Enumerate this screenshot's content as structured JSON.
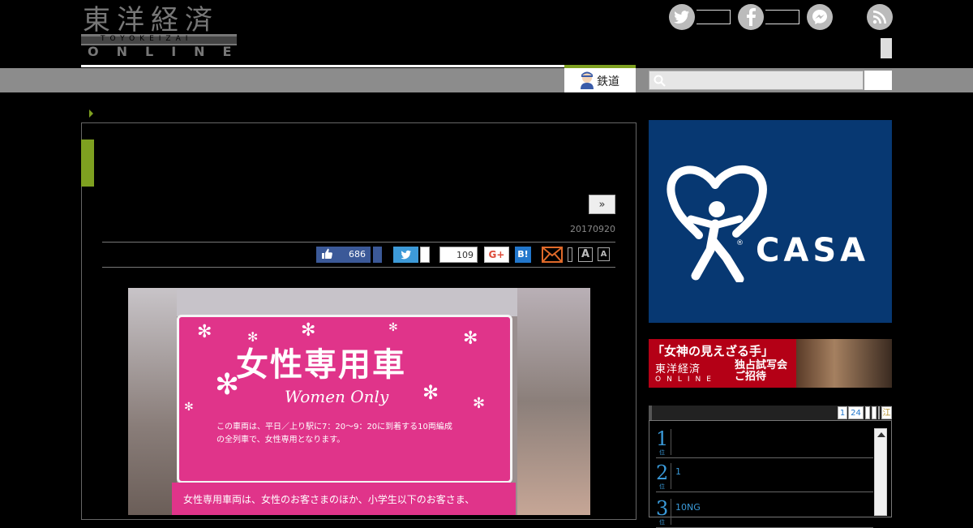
{
  "header": {
    "logo_kanji": "東洋経済",
    "logo_roman": "TOYOKEIZAI",
    "logo_online": "ONLINE"
  },
  "nav": {
    "active_tab": "鉄道",
    "search_placeholder": ""
  },
  "article": {
    "next_button": "»",
    "date": "20170920",
    "like_count": "686",
    "hatena_count": "109",
    "google_plus": "G+",
    "hatena_label": "B!",
    "font_size_large": "A",
    "font_size_small": "A"
  },
  "photo": {
    "sign_title": "女性専用車",
    "sign_subtitle": "Women Only",
    "sign_notice_1": "この車両は、平日／上り駅に7：20〜9：20に到着する10両編成",
    "sign_notice_2": "の全列車で、女性専用となります。",
    "sign_lower": "女性専用車両は、女性のお客さまのほか、小学生以下のお客さま、"
  },
  "ads": {
    "casa_brand": "CASA",
    "movie_title": "「女神の見えざる手」",
    "movie_brand": "東洋経済",
    "movie_offer": "独占試写会",
    "movie_invite": "ご招待",
    "movie_online": "ONLINE"
  },
  "ranking": {
    "tabs": [
      "1",
      "24",
      "",
      "",
      "",
      "江"
    ],
    "items": [
      {
        "rank": "1",
        "suffix": "位",
        "text": ""
      },
      {
        "rank": "2",
        "suffix": "位",
        "text": "1"
      },
      {
        "rank": "3",
        "suffix": "位",
        "text": "10NG"
      }
    ]
  }
}
